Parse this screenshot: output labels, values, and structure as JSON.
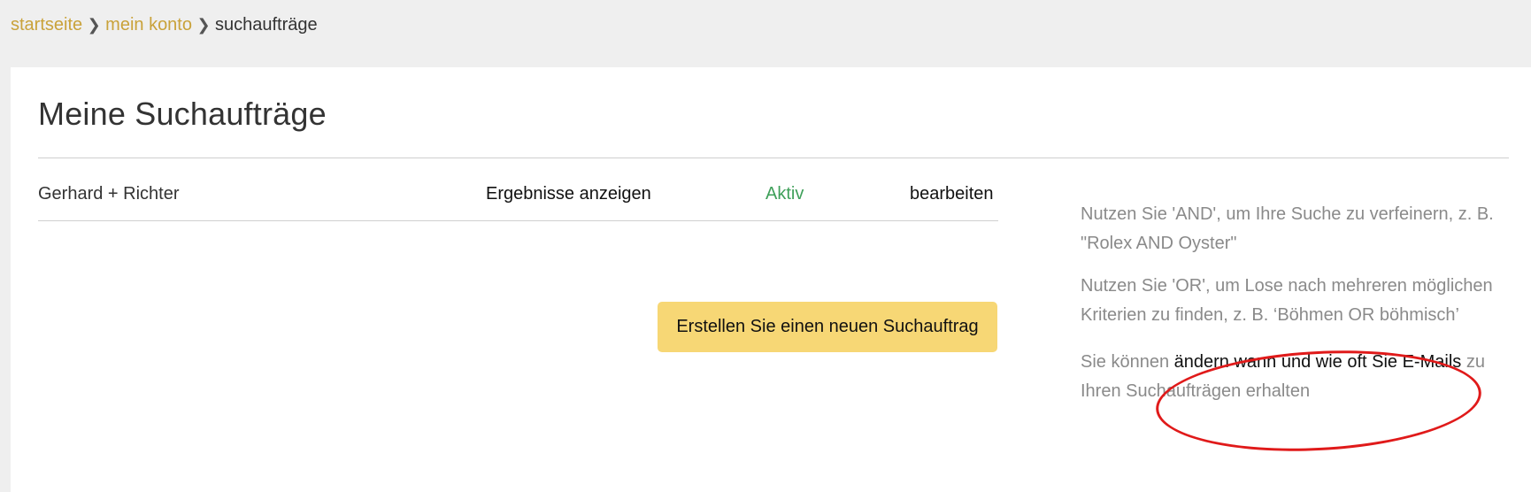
{
  "breadcrumb": {
    "items": [
      {
        "label": "startseite"
      },
      {
        "label": "mein konto"
      }
    ],
    "current": "suchaufträge",
    "separator": ">"
  },
  "page": {
    "title": "Meine Suchaufträge"
  },
  "search_orders": [
    {
      "name": "Gerhard + Richter",
      "results_link": "Ergebnisse anzeigen",
      "status": "Aktiv",
      "edit_link": "bearbeiten"
    }
  ],
  "actions": {
    "create_label": "Erstellen Sie einen neuen Suchauftrag"
  },
  "help": {
    "and_tip": "Nutzen Sie 'AND', um Ihre Suche zu verfeinern, z. B. \"Rolex AND Oyster\"",
    "or_tip": "Nutzen Sie 'OR', um Lose nach mehreren möglichen Kriterien zu finden, z. B. ‘Böhmen OR böhmisch’",
    "email_prefix": "Sie können ",
    "email_link": "ändern wann und wie oft Sie E-Mails",
    "email_suffix": " zu Ihren Suchaufträgen erhalten"
  },
  "colors": {
    "accent_link": "#c9a23a",
    "status_active": "#3fa05a",
    "button_bg": "#f7d775",
    "annotation": "#e01a1a"
  }
}
